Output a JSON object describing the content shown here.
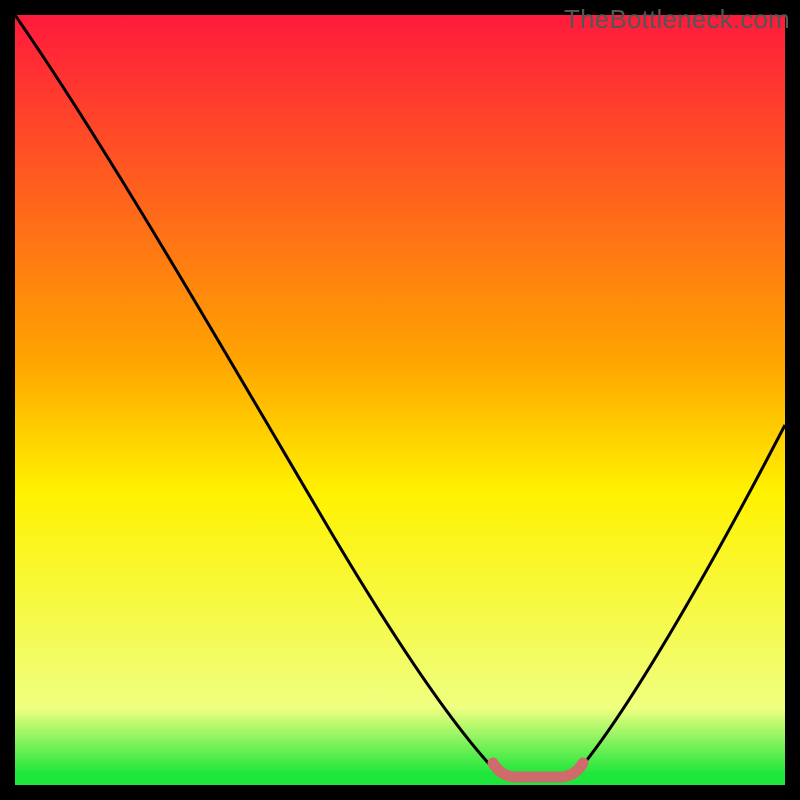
{
  "watermark": "TheBottleneck.com",
  "colors": {
    "frame": "#000000",
    "curve": "#000000",
    "green": "#1FE63B",
    "yellow": "#FFF200",
    "orange": "#FFA500",
    "red": "#FF1A3C",
    "pink_marker": "#CE6B6B"
  },
  "chart_data": {
    "type": "line",
    "title": "",
    "xlabel": "",
    "ylabel": "",
    "xlim": [
      0,
      100
    ],
    "ylim": [
      0,
      100
    ],
    "x": [
      0,
      5,
      10,
      15,
      20,
      25,
      30,
      35,
      40,
      45,
      50,
      55,
      60,
      63,
      66,
      70,
      72,
      75,
      80,
      85,
      90,
      95,
      100
    ],
    "values": [
      100,
      92,
      83,
      75,
      66,
      58,
      49,
      41,
      32,
      24,
      15,
      9,
      4,
      1,
      0,
      0,
      1,
      4,
      11,
      20,
      30,
      41,
      53
    ],
    "optimal_range_x": [
      63,
      72
    ],
    "marker_y": 1,
    "gradient_stops": [
      {
        "pos": 0.0,
        "color": "#FF1A3C"
      },
      {
        "pos": 0.45,
        "color": "#FFA500"
      },
      {
        "pos": 0.62,
        "color": "#FFF200"
      },
      {
        "pos": 0.9,
        "color": "#EFFF80"
      },
      {
        "pos": 0.985,
        "color": "#1FE63B"
      },
      {
        "pos": 1.0,
        "color": "#1FE63B"
      }
    ]
  }
}
